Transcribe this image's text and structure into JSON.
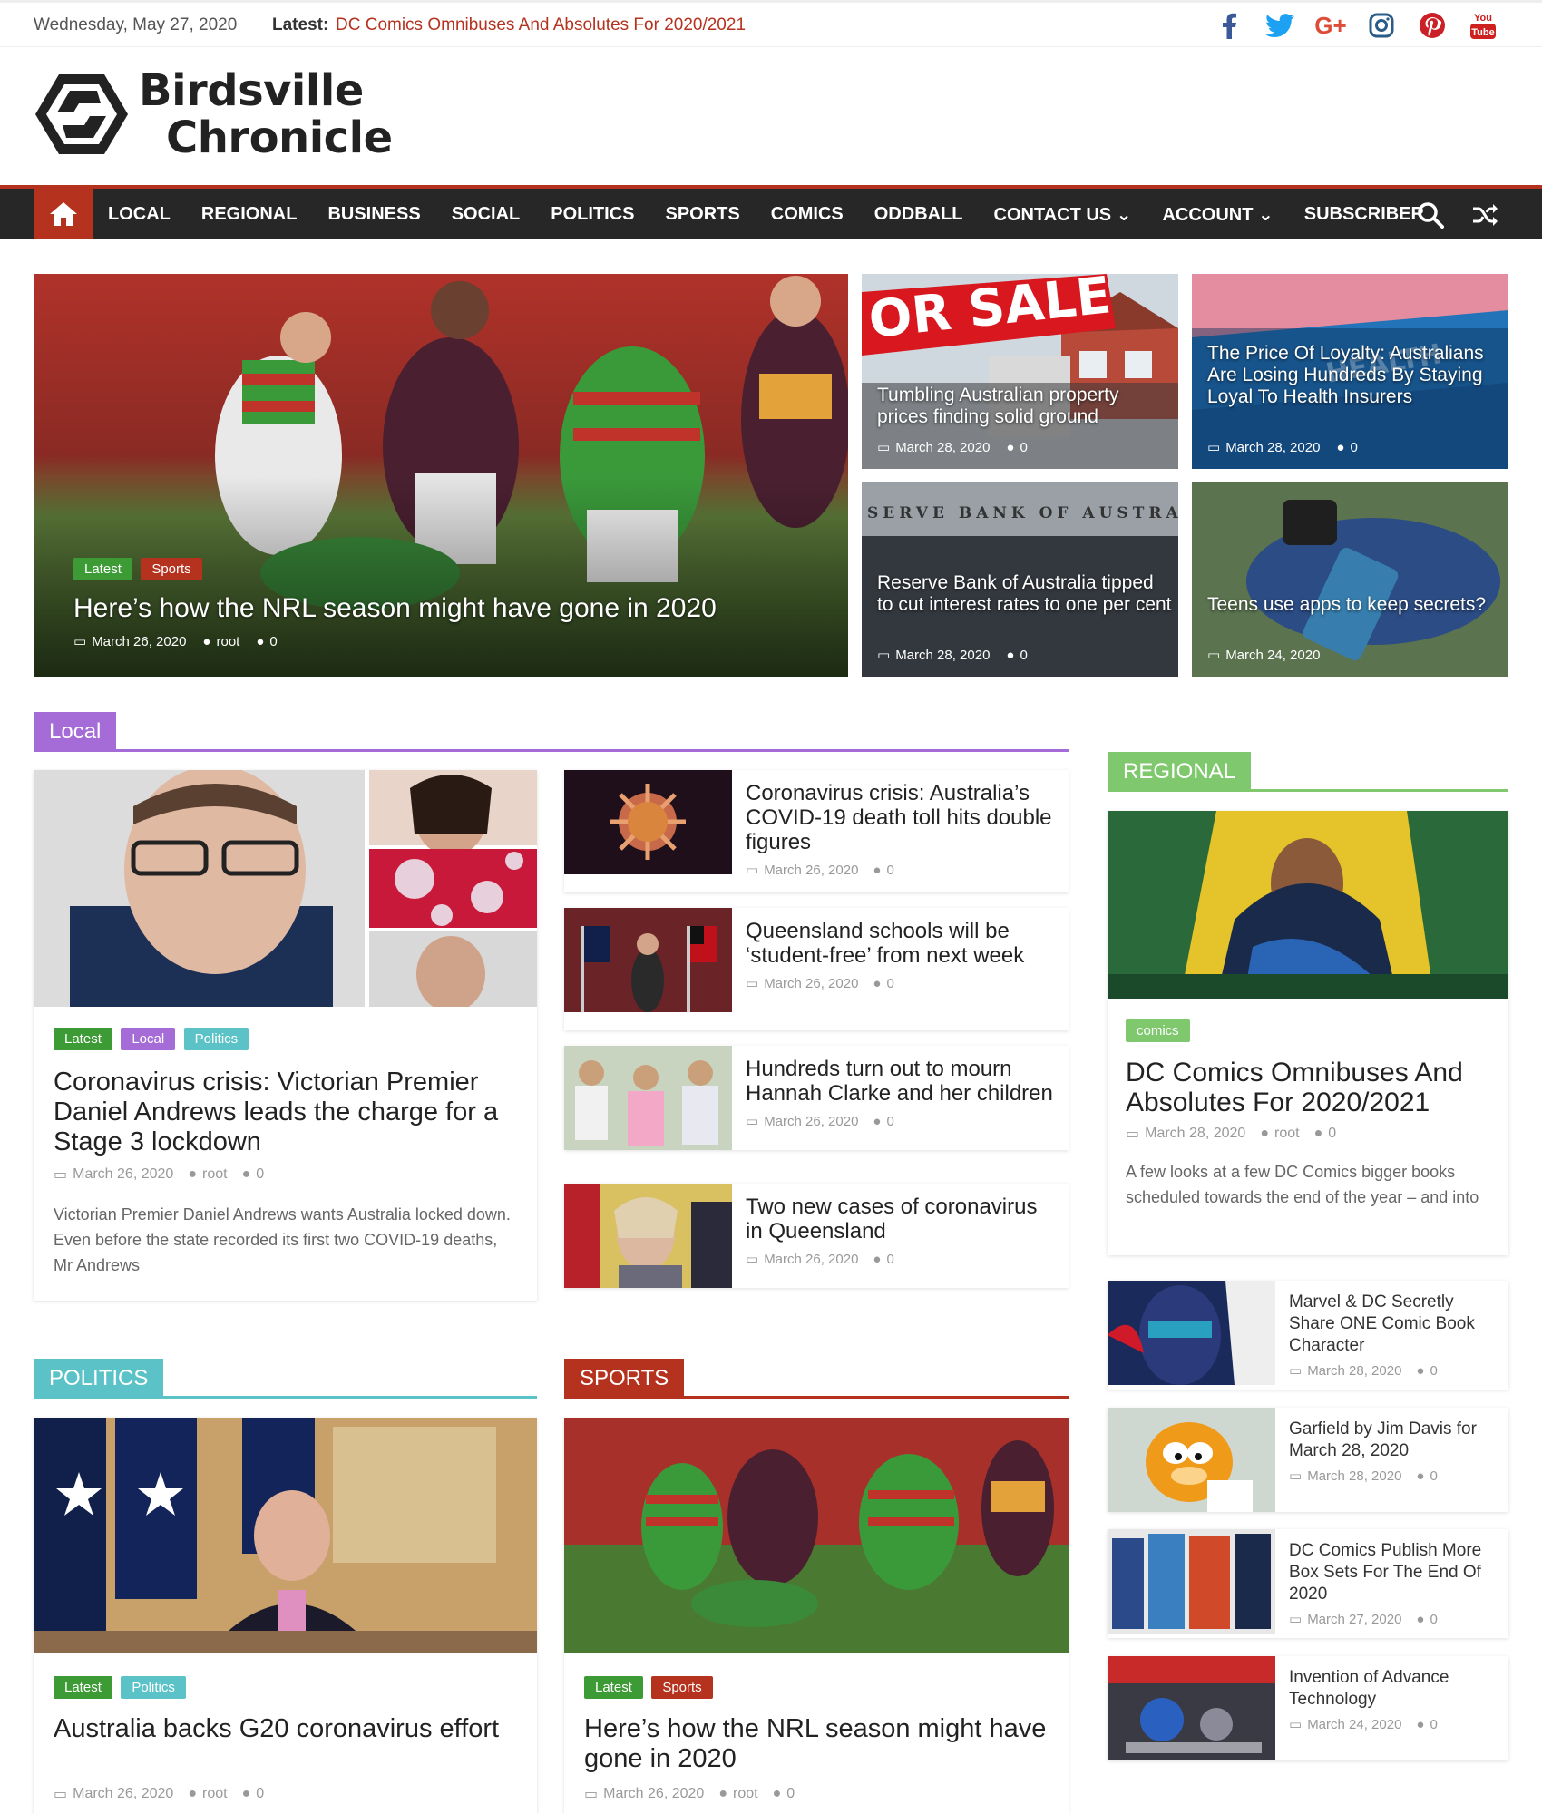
{
  "topbar": {
    "date": "Wednesday, May 27, 2020",
    "latest_label": "Latest:",
    "latest_link": "DC Comics Omnibuses And Absolutes For 2020/2021",
    "social": [
      "facebook-icon",
      "twitter-icon",
      "google-plus-icon",
      "instagram-icon",
      "pinterest-icon",
      "youtube-icon"
    ]
  },
  "logo": {
    "line1": "Birdsville",
    "line2": "Chronicle"
  },
  "nav": {
    "items": [
      "LOCAL",
      "REGIONAL",
      "BUSINESS",
      "SOCIAL",
      "POLITICS",
      "SPORTS",
      "COMICS",
      "ODDBALL",
      "CONTACT US ⌄",
      "ACCOUNT ⌄",
      "SUBSCRIBER"
    ]
  },
  "colors": {
    "accent": "#b5321f",
    "nav_bg": "#272727",
    "local": "#a56bd6",
    "regional": "#7fc86e",
    "politics": "#5bc2c7",
    "sports": "#b5321f"
  },
  "hero": {
    "main": {
      "cats": [
        "Latest",
        "Sports"
      ],
      "title": "Here’s how the NRL season might have gone in 2020",
      "date": "March 26, 2020",
      "author": "root",
      "comments": "0"
    },
    "tiles": [
      {
        "title": "Tumbling Australian property prices finding solid ground",
        "date": "March 28, 2020",
        "comments": "0"
      },
      {
        "title": "The Price Of Loyalty: Australians Are Losing Hundreds By Staying Loyal To Health Insurers",
        "date": "March 28, 2020",
        "comments": "0"
      },
      {
        "title": "Reserve Bank of Australia tipped to cut interest rates to one per cent",
        "date": "March 28, 2020",
        "comments": "0"
      },
      {
        "title": "Teens use apps to keep secrets?",
        "date": "March 24, 2020"
      }
    ]
  },
  "local": {
    "heading": "Local",
    "featured": {
      "cats": [
        "Latest",
        "Local",
        "Politics"
      ],
      "title": "Coronavirus crisis: Victorian Premier Daniel Andrews leads the charge for a Stage 3 lockdown",
      "date": "March 26, 2020",
      "author": "root",
      "comments": "0",
      "excerpt": "Victorian Premier Daniel Andrews wants Australia locked down. Even before the state recorded its first two COVID-19 deaths, Mr Andrews"
    },
    "list": [
      {
        "title": "Coronavirus crisis: Australia’s COVID-19 death toll hits double figures",
        "date": "March 26, 2020",
        "comments": "0"
      },
      {
        "title": "Queensland schools will be ‘student-free’ from next week",
        "date": "March 26, 2020",
        "comments": "0"
      },
      {
        "title": "Hundreds turn out to mourn Hannah Clarke and her children",
        "date": "March 26, 2020",
        "comments": "0"
      },
      {
        "title": "Two new cases of coronavirus in Queensland",
        "date": "March 26, 2020",
        "comments": "0"
      }
    ]
  },
  "regional": {
    "heading": "REGIONAL",
    "featured": {
      "cat": "comics",
      "title": "DC Comics Omnibuses And Absolutes For 2020/2021",
      "date": "March 28, 2020",
      "author": "root",
      "comments": "0",
      "excerpt": "A few looks at a few DC Comics bigger books scheduled towards the end of the year – and into"
    },
    "list": [
      {
        "title": "Marvel & DC Secretly Share ONE Comic Book Character",
        "date": "March 28, 2020",
        "comments": "0"
      },
      {
        "title": "Garfield by Jim Davis for March 28, 2020",
        "date": "March 28, 2020",
        "comments": "0"
      },
      {
        "title": "DC Comics Publish More Box Sets For The End Of 2020",
        "date": "March 27, 2020",
        "comments": "0"
      },
      {
        "title": "Invention of Advance Technology",
        "date": "March 24, 2020",
        "comments": "0"
      }
    ]
  },
  "politics": {
    "heading": "POLITICS",
    "featured": {
      "cats": [
        "Latest",
        "Politics"
      ],
      "title": "Australia backs G20 coronavirus effort",
      "date": "March 26, 2020",
      "author": "root",
      "comments": "0"
    }
  },
  "sports": {
    "heading": "SPORTS",
    "featured": {
      "cats": [
        "Latest",
        "Sports"
      ],
      "title": "Here’s how the NRL season might have gone in 2020",
      "date": "March 26, 2020",
      "author": "root",
      "comments": "0"
    }
  }
}
